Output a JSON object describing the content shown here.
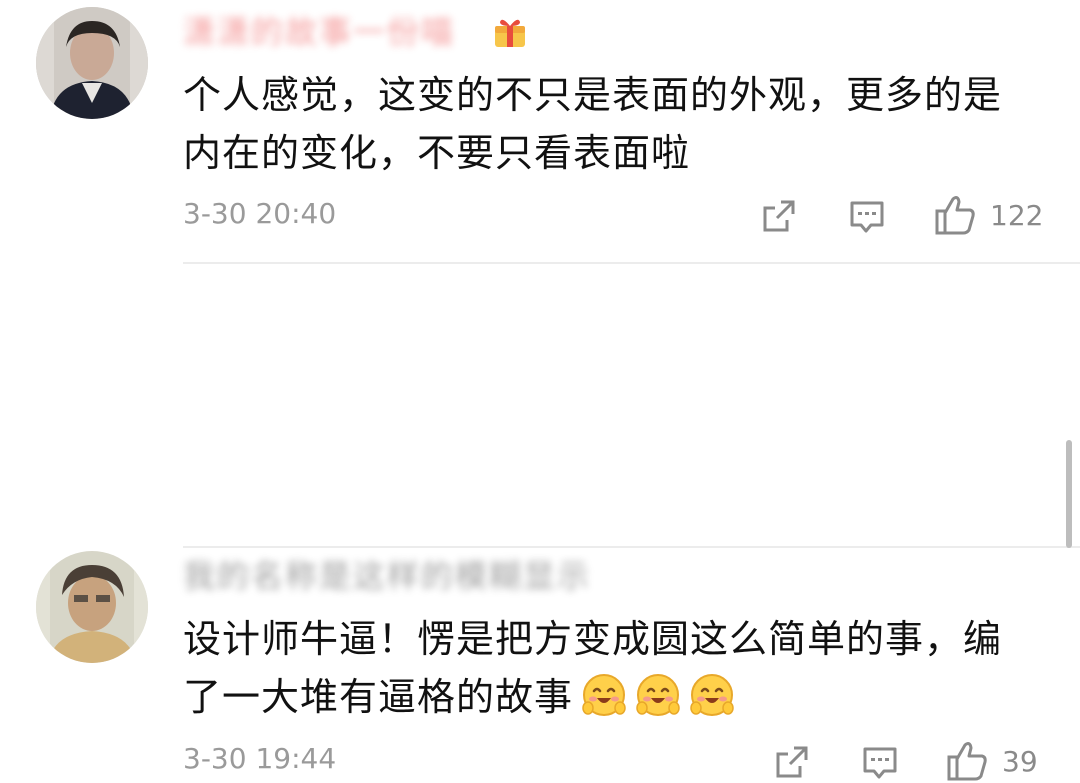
{
  "comments": [
    {
      "username": "潇潇的故事一份喵",
      "text_line1": "个人感觉，这变的不只是表面的外观，更多的是",
      "text_line2": "内在的变化，不要只看表面啦",
      "timestamp": "3-30 20:40",
      "likes": "122",
      "has_badge": true
    },
    {
      "username": "我的名称是这样的模糊显示",
      "text_line1": "设计师牛逼！愣是把方变成圆这么简单的事，编",
      "text_line2": "了一大堆有逼格的故事",
      "timestamp": "3-30 19:44",
      "likes": "39",
      "emoji_count": 3
    }
  ],
  "icons": {
    "share": "share-icon",
    "reply": "comment-icon",
    "like": "thumbs-up-icon",
    "badge": "gift-badge-icon",
    "emoji": "smiling-face-emoji"
  },
  "colors": {
    "text": "#111111",
    "meta": "#9a9a9a",
    "icon": "#8a8a8a",
    "username_vip": "#f06a6a",
    "divider": "#ececec"
  }
}
